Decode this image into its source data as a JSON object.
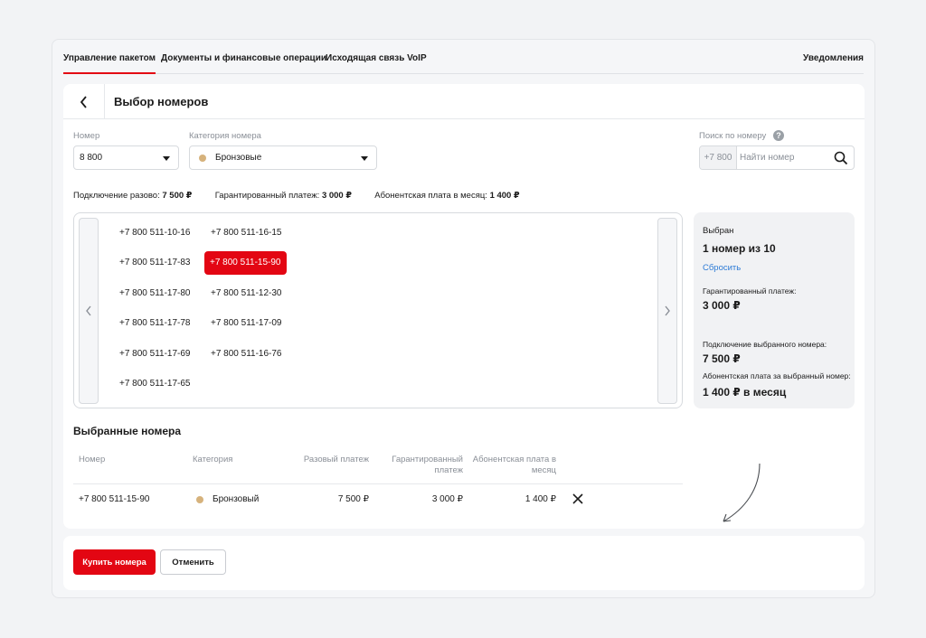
{
  "nav": {
    "tabs": [
      {
        "label": "Управление пакетом",
        "active": true
      },
      {
        "label": "Документы и финансовые операции",
        "active": false
      },
      {
        "label": "Исходящая связь VoIP",
        "active": false
      }
    ],
    "notifications": "Уведомления"
  },
  "header": {
    "title": "Выбор номеров",
    "back_icon": "chevron-left-icon"
  },
  "filters": {
    "number_label": "Номер",
    "number_value": "8 800",
    "category_label": "Категория номера",
    "category_value": "Бронзовые",
    "category_color": "#d6b27c",
    "search_label": "Поиск по номеру",
    "search_prefix": "+7 800",
    "search_placeholder": "Найти номер"
  },
  "fees": {
    "connection_label": "Подключение разово:",
    "connection_value": "7 500 ₽",
    "guaranteed_label": "Гарантированный платеж:",
    "guaranteed_value": "3 000 ₽",
    "monthly_label": "Абонентская плата в месяц:",
    "monthly_value": "1 400 ₽"
  },
  "numbers": {
    "col1": [
      "+7 800 511-10-16",
      "+7 800 511-17-83",
      "+7 800 511-17-80",
      "+7 800 511-17-78",
      "+7 800 511-17-69",
      "+7 800 511-17-65"
    ],
    "col2": [
      "+7 800 511-16-15",
      "+7 800 511-15-90",
      "+7 800 511-12-30",
      "+7 800 511-17-09",
      "+7 800 511-16-76"
    ],
    "selected": "+7 800 511-15-90"
  },
  "summary": {
    "chosen_label": "Выбран",
    "chosen_value": "1 номер из 10",
    "reset": "Сбросить",
    "guaranteed_label": "Гарантированный платеж:",
    "guaranteed_value": "3 000 ₽",
    "connection_label": "Подключение выбранного номера:",
    "connection_value": "7 500 ₽",
    "monthly_label": "Абонентская плата за выбранный номер:",
    "monthly_value": "1 400 ₽ в месяц"
  },
  "selected_table": {
    "title": "Выбранные номера",
    "headers": {
      "number": "Номер",
      "category": "Категория",
      "one_time": "Разовый платеж",
      "guaranteed": "Гарантированный платеж",
      "monthly": "Абонентская плата в месяц"
    },
    "rows": [
      {
        "number": "+7 800 511-15-90",
        "category": "Бронзовый",
        "one_time": "7 500 ₽",
        "guaranteed": "3 000 ₽",
        "monthly": "1 400 ₽"
      }
    ]
  },
  "actions": {
    "buy": "Купить номера",
    "cancel": "Отменить"
  },
  "colors": {
    "accent": "#e30613",
    "link": "#2d7bd6",
    "bronze": "#d6b27c"
  }
}
